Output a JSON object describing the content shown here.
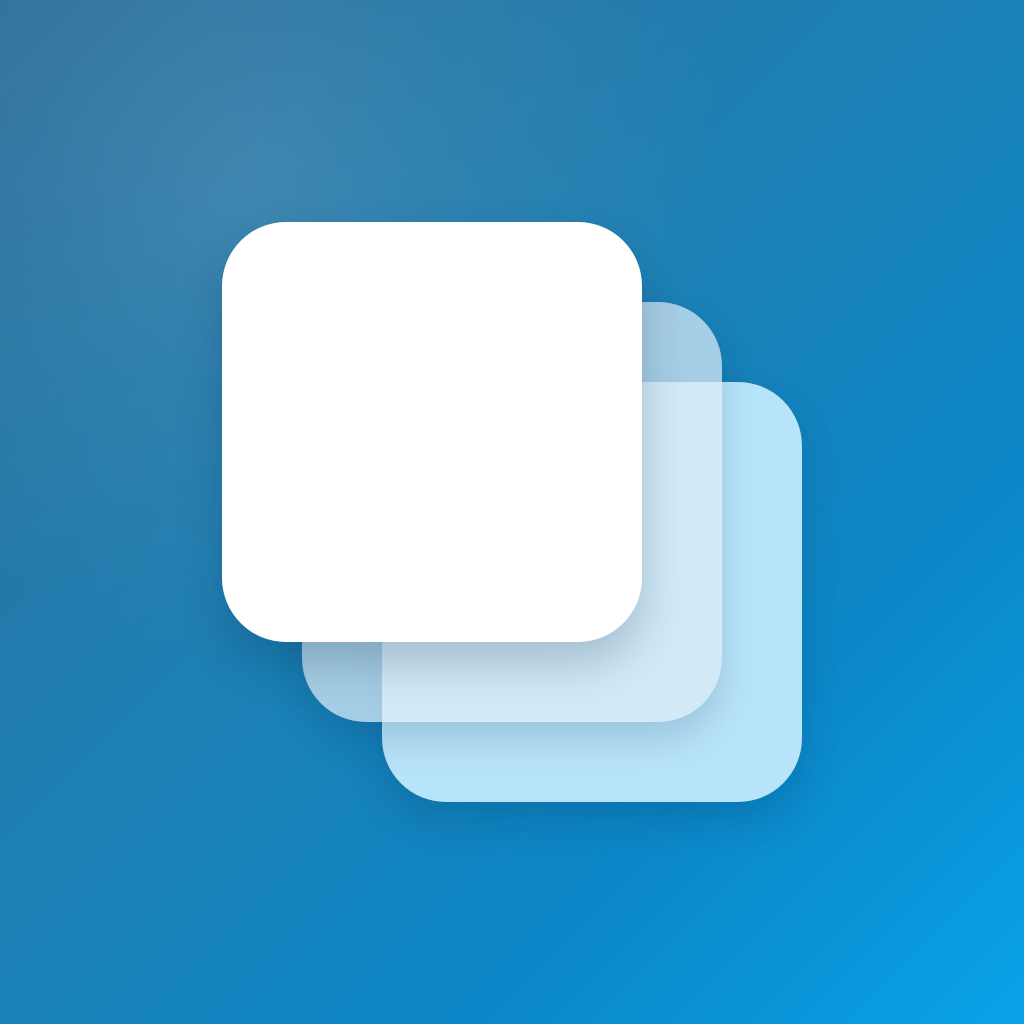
{
  "app_icon": {
    "name": "stacked-layers-icon",
    "colors": {
      "background_start": "#2c6f99",
      "background_mid": "#1e7fb2",
      "background_end": "#0aa2e8",
      "front_layer": "#ffffff",
      "middle_layer": "#dcecf5",
      "middle_layer_alpha": 0.72,
      "back_layer": "#b8e4fa"
    }
  }
}
